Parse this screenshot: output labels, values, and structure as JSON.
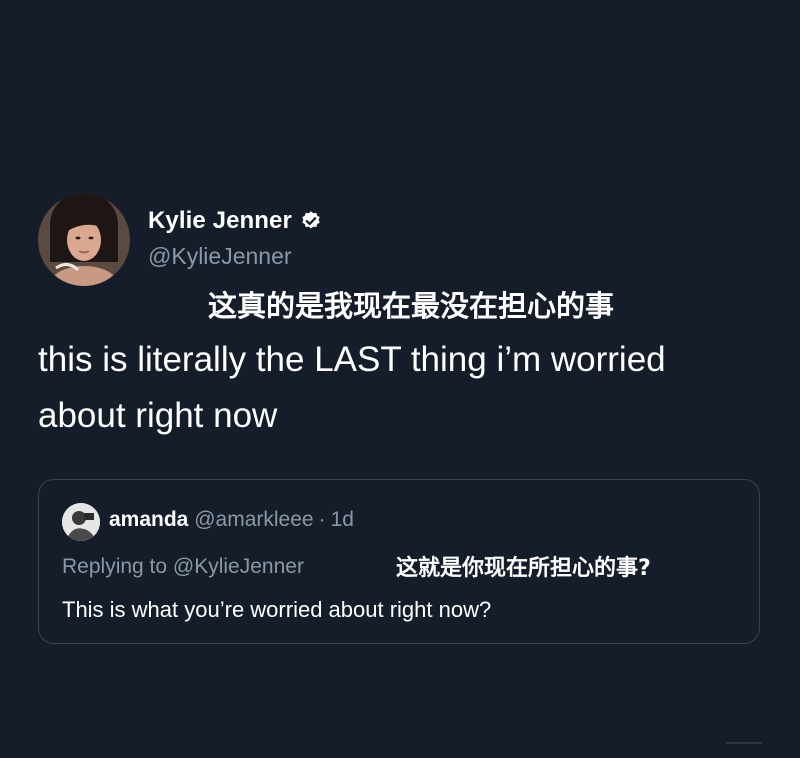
{
  "tweet": {
    "author_name": "Kylie Jenner",
    "author_handle": "@KylieJenner",
    "verified_icon": "verified-badge-icon",
    "translation": "这真的是我现在最没在担心的事",
    "text": "this is literally the LAST thing i’m worried about right now"
  },
  "quote": {
    "name": "amanda",
    "handle": "@amarkleee",
    "separator": "·",
    "time": "1d",
    "replying_prefix": "Replying to",
    "replying_to": "@KylieJenner",
    "translation": "这就是你现在所担心的事?",
    "text": "This is what you’re worried about right now?"
  },
  "colors": {
    "background": "#151d2a",
    "secondary_text": "#8b98a5",
    "border": "#38444d",
    "verified": "#ffffff"
  }
}
